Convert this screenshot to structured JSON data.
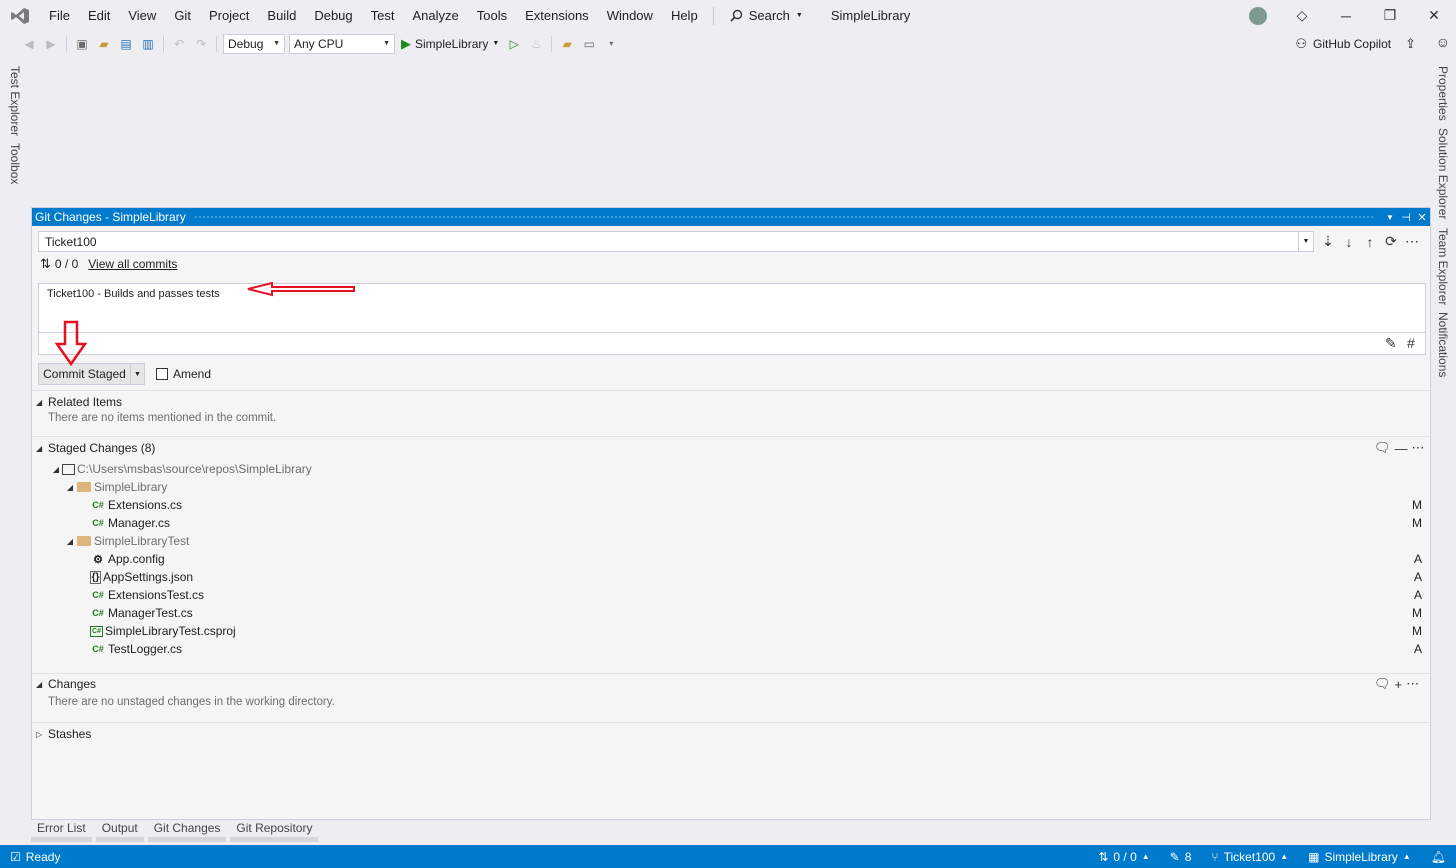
{
  "menu": {
    "items": [
      "File",
      "Edit",
      "View",
      "Git",
      "Project",
      "Build",
      "Debug",
      "Test",
      "Analyze",
      "Tools",
      "Extensions",
      "Window",
      "Help"
    ],
    "search_label": "Search",
    "solution_title": "SimpleLibrary"
  },
  "toolbar": {
    "config": "Debug",
    "platform": "Any CPU",
    "run_target": "SimpleLibrary",
    "copilot_label": "GitHub Copilot"
  },
  "left_rail": [
    "Test Explorer",
    "Toolbox"
  ],
  "right_rail": [
    "Properties",
    "Solution Explorer",
    "Team Explorer",
    "Notifications"
  ],
  "git_changes": {
    "title": "Git Changes - SimpleLibrary",
    "branch": "Ticket100",
    "commit_counts": "0 / 0",
    "view_all_commits": "View all commits",
    "commit_message": "Ticket100 - Builds and passes tests",
    "commit_button": "Commit Staged",
    "amend_label": "Amend",
    "related_items": {
      "title": "Related Items",
      "empty_text": "There are no items mentioned in the commit."
    },
    "staged": {
      "title": "Staged Changes (8)",
      "repo_path": "C:\\Users\\msbas\\source\\repos\\SimpleLibrary",
      "folders": [
        {
          "name": "SimpleLibrary",
          "files": [
            {
              "name": "Extensions.cs",
              "icon": "csharp-icon",
              "status": "M"
            },
            {
              "name": "Manager.cs",
              "icon": "csharp-icon",
              "status": "M"
            }
          ]
        },
        {
          "name": "SimpleLibraryTest",
          "files": [
            {
              "name": "App.config",
              "icon": "config-icon",
              "status": "A"
            },
            {
              "name": "AppSettings.json",
              "icon": "json-icon",
              "status": "A"
            },
            {
              "name": "ExtensionsTest.cs",
              "icon": "csharp-icon",
              "status": "A"
            },
            {
              "name": "ManagerTest.cs",
              "icon": "csharp-icon",
              "status": "M"
            },
            {
              "name": "SimpleLibraryTest.csproj",
              "icon": "csproj-icon",
              "status": "M"
            },
            {
              "name": "TestLogger.cs",
              "icon": "csharp-icon",
              "status": "A"
            }
          ]
        }
      ]
    },
    "changes": {
      "title": "Changes",
      "empty_text": "There are no unstaged changes in the working directory."
    },
    "stashes": {
      "title": "Stashes"
    }
  },
  "bottom_tabs": [
    "Error List",
    "Output",
    "Git Changes",
    "Git Repository"
  ],
  "statusbar": {
    "ready": "Ready",
    "sync": "0 / 0",
    "pending_edits": "8",
    "branch": "Ticket100",
    "repo": "SimpleLibrary"
  },
  "colors": {
    "accent": "#007acc",
    "annotation": "#e81123",
    "csharp_icon": "#1e7a1e",
    "folder": "#dcb67a"
  }
}
